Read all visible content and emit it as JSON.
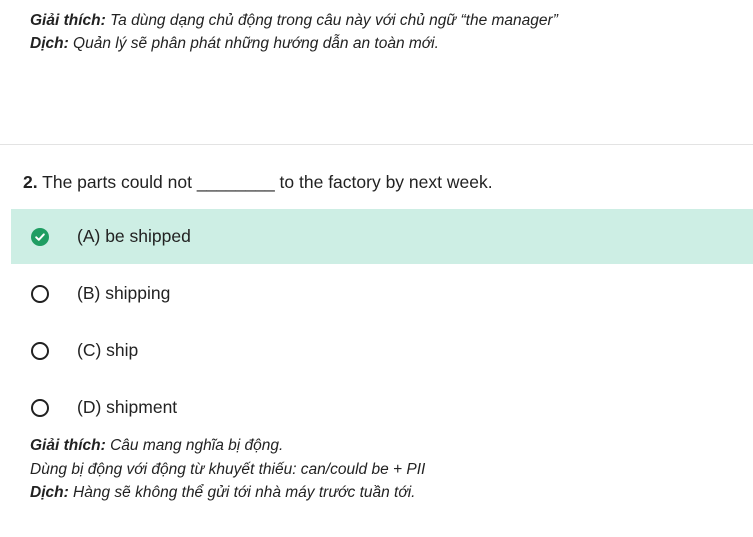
{
  "prev_explanation": {
    "explain_label": "Giải thích:",
    "explain_text": " Ta dùng dạng chủ động trong câu này với chủ ngữ “the manager”",
    "translate_label": "Dịch:",
    "translate_text": " Quản lý sẽ phân phát những hướng dẫn an toàn mới."
  },
  "question": {
    "number": "2.",
    "text": " The parts could not ________ to the factory by next week."
  },
  "options": [
    {
      "label": "(A) be shipped",
      "state": "correct"
    },
    {
      "label": "(B) shipping",
      "state": "unselected"
    },
    {
      "label": "(C) ship",
      "state": "unselected"
    },
    {
      "label": "(D) shipment",
      "state": "unselected"
    }
  ],
  "explanation": {
    "explain_label": "Giải thích:",
    "explain_text": " Câu mang nghĩa bị động.",
    "line2": "Dùng bị động với động từ khuyết thiếu: can/could be + PII",
    "translate_label": "Dịch:",
    "translate_text": " Hàng sẽ không thể gửi tới nhà máy trước tuần tới."
  },
  "colors": {
    "correct_bg": "#cdeee4",
    "check_green": "#1f9d62"
  }
}
